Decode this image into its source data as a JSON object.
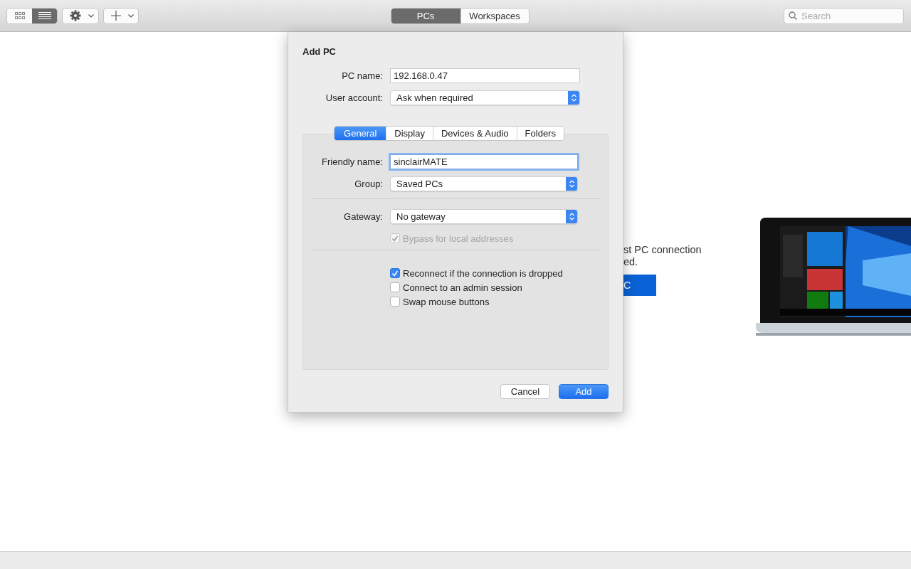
{
  "toolbar": {
    "view_buttons": [
      {
        "kind": "grid",
        "selected": false
      },
      {
        "kind": "list",
        "selected": true
      }
    ],
    "menu_buttons": [
      {
        "kind": "gear"
      },
      {
        "kind": "plus"
      }
    ],
    "segments": [
      {
        "label": "PCs",
        "selected": true
      },
      {
        "label": "Workspaces",
        "selected": false
      }
    ],
    "search": {
      "placeholder": "Search"
    }
  },
  "background": {
    "message_lines": [
      "st PC connection",
      "ed."
    ],
    "button": "C",
    "picture": {
      "kind": "picture"
    }
  },
  "dialog": {
    "title": "Add PC",
    "pc_name": {
      "label": "PC name:",
      "value": "192.168.0.47",
      "kind": "text",
      "focused": false
    },
    "user_account": {
      "label": "User account:",
      "value": "Ask when required",
      "kind": "select"
    },
    "tabs": [
      {
        "label": "General",
        "selected": true
      },
      {
        "label": "Display",
        "selected": false
      },
      {
        "label": "Devices & Audio",
        "selected": false
      },
      {
        "label": "Folders",
        "selected": false
      }
    ],
    "friendly_name": {
      "label": "Friendly name:",
      "value": "sinclairMATE",
      "kind": "text",
      "focused": true
    },
    "group": {
      "label": "Group:",
      "value": "Saved PCs",
      "kind": "select"
    },
    "gateway": {
      "label": "Gateway:",
      "value": "No gateway",
      "kind": "select"
    },
    "bypass": {
      "label": "Bypass for local addresses",
      "checked": true,
      "disabled": true
    },
    "options": [
      {
        "label": "Reconnect if the connection is dropped",
        "checked": true,
        "disabled": false
      },
      {
        "label": "Connect to an admin session",
        "checked": false,
        "disabled": false
      },
      {
        "label": "Swap mouse buttons",
        "checked": false,
        "disabled": false
      }
    ],
    "buttons": [
      {
        "label": "Cancel",
        "kind": "secondary"
      },
      {
        "label": "Add",
        "kind": "primary"
      }
    ]
  }
}
